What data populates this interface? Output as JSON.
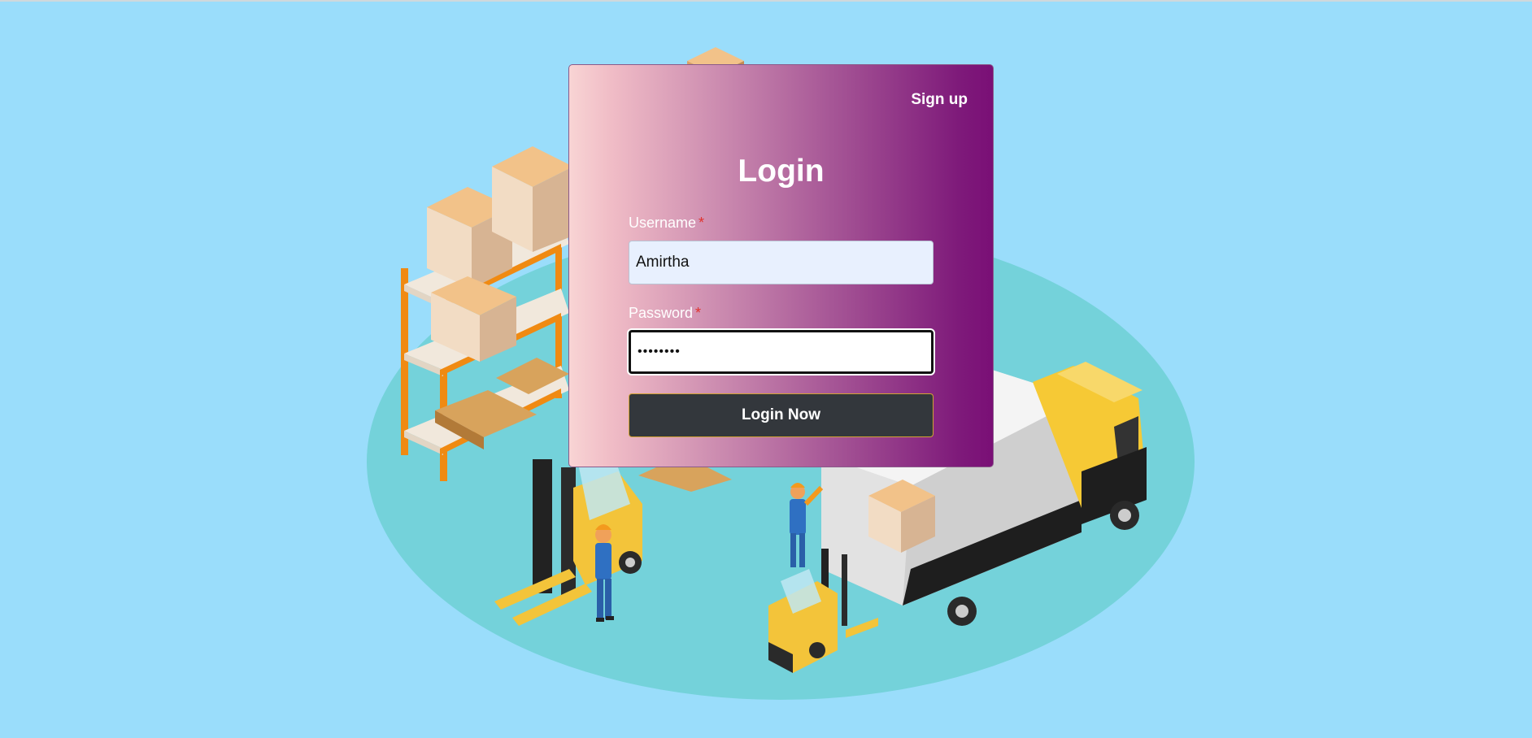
{
  "auth": {
    "signup_link": "Sign up",
    "title": "Login",
    "username": {
      "label": "Username",
      "required_mark": "*",
      "value": "Amirtha"
    },
    "password": {
      "label": "Password",
      "required_mark": "*",
      "value": "••••••••"
    },
    "submit_label": "Login Now"
  },
  "background": {
    "sky_color": "#9addfb",
    "floor_color": "#74d2da",
    "illustration": "warehouse-logistics-illustration"
  },
  "colors": {
    "card_gradient_start": "#f8d4d4",
    "card_gradient_end": "#7a0f76",
    "button_bg": "#33373c",
    "button_border": "#d2a233",
    "required_star": "#e0332e"
  }
}
